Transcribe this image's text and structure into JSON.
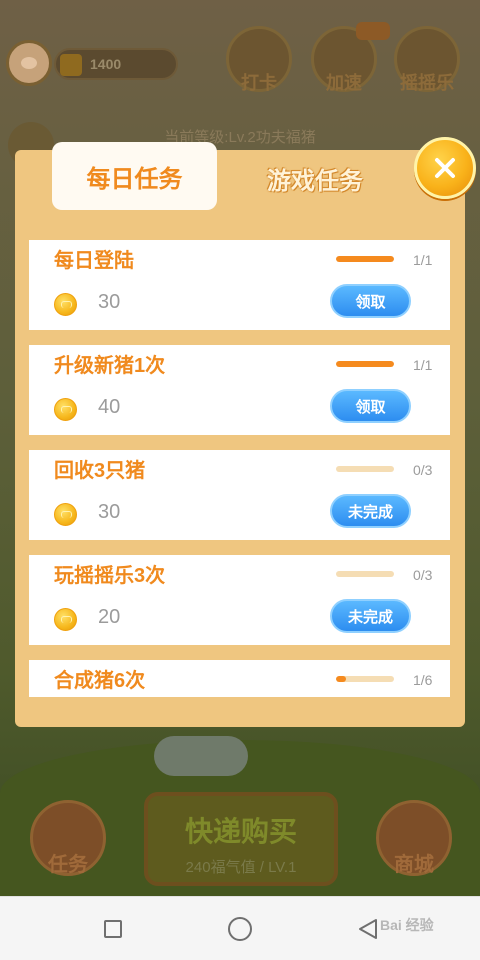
{
  "background": {
    "level_text": "当前等级:Lv.2功夫福猪",
    "coin_value": "1400",
    "top_buttons": [
      {
        "label": "打卡"
      },
      {
        "label": "加速"
      },
      {
        "label": "摇摇乐"
      }
    ],
    "bottom_left_label": "任务",
    "bottom_right_label": "商城",
    "buy_title": "快递购买",
    "buy_sub": "240福气值 / LV.1"
  },
  "modal": {
    "tabs": {
      "daily": "每日任务",
      "game": "游戏任务",
      "active": "daily"
    },
    "close_icon": "close-x-icon",
    "tasks": [
      {
        "name": "每日登陆",
        "progress": "1/1",
        "progress_fraction": 1.0,
        "reward": "30",
        "button": "领取"
      },
      {
        "name": "升级新猪1次",
        "progress": "1/1",
        "progress_fraction": 1.0,
        "reward": "40",
        "button": "领取"
      },
      {
        "name": "回收3只猪",
        "progress": "0/3",
        "progress_fraction": 0.0,
        "reward": "30",
        "button": "未完成"
      },
      {
        "name": "玩摇摇乐3次",
        "progress": "0/3",
        "progress_fraction": 0.0,
        "reward": "20",
        "button": "未完成"
      },
      {
        "name": "合成猪6次",
        "progress": "1/6",
        "progress_fraction": 0.1667
      }
    ]
  },
  "navbar": {
    "recent_icon": "square-recents-icon",
    "home_icon": "circle-home-icon",
    "back_icon": "triangle-back-icon",
    "watermark": "Bai 经验"
  },
  "colors": {
    "modal_bg": "#efc680",
    "accent_orange": "#f08a1e",
    "button_blue": "#2d8df0",
    "close_yellow": "#f9b21a"
  }
}
